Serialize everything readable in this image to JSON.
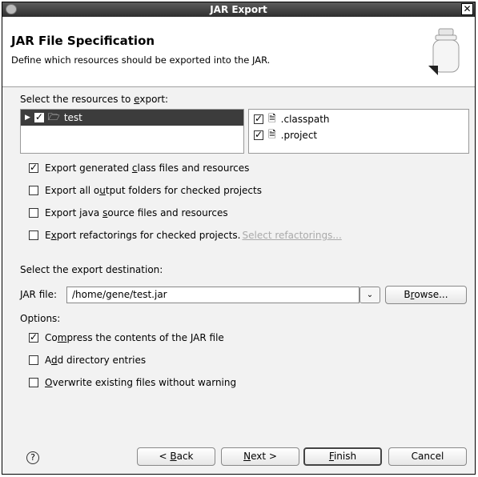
{
  "window": {
    "title": "JAR Export"
  },
  "header": {
    "title": "JAR File Specification",
    "description": "Define which resources should be exported into the JAR."
  },
  "resources": {
    "label_pre": "Select the resources to ",
    "label_mn": "e",
    "label_post": "xport:",
    "tree": [
      {
        "label": "test",
        "checked": true,
        "selected": true
      }
    ],
    "files": [
      {
        "label": ".classpath",
        "checked": true
      },
      {
        "label": ".project",
        "checked": true
      }
    ]
  },
  "export_options": [
    {
      "pre": "Export generated ",
      "mn": "c",
      "post": "lass files and resources",
      "checked": true
    },
    {
      "pre": "Export all o",
      "mn": "u",
      "post": "tput folders for checked projects",
      "checked": false
    },
    {
      "pre": "Export java ",
      "mn": "s",
      "post": "ource files and resources",
      "checked": false
    },
    {
      "pre": "E",
      "mn": "x",
      "post": "port refactorings for checked projects.",
      "checked": false,
      "link": "Select refactorings..."
    }
  ],
  "destination": {
    "label": "Select the export destination:",
    "jar_label": "JAR file:",
    "jar_value": "/home/gene/test.jar",
    "browse_pre": "B",
    "browse_mn": "r",
    "browse_post": "owse..."
  },
  "options": {
    "label": "Options:",
    "items": [
      {
        "pre": "Co",
        "mn": "m",
        "post": "press the contents of the JAR file",
        "checked": true
      },
      {
        "pre": "A",
        "mn": "d",
        "post": "d directory entries",
        "checked": false
      },
      {
        "pre": "",
        "mn": "O",
        "post": "verwrite existing files without warning",
        "checked": false
      }
    ]
  },
  "buttons": {
    "back_pre": "< ",
    "back_mn": "B",
    "back_post": "ack",
    "next_pre": "",
    "next_mn": "N",
    "next_post": "ext >",
    "finish_pre": "",
    "finish_mn": "F",
    "finish_post": "inish",
    "cancel": "Cancel"
  },
  "icons": {
    "help": "help-icon",
    "jar": "jar-icon"
  }
}
